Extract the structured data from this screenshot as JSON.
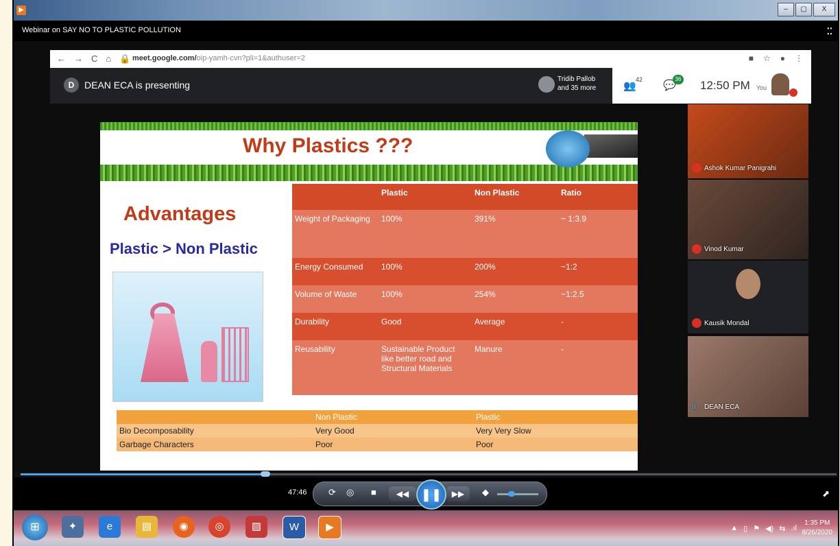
{
  "window": {
    "title": "Webinar on SAY NO TO PLASTIC POLLUTION",
    "minimize": "–",
    "maximize": "▢",
    "close": "X"
  },
  "browser": {
    "url_main": "meet.google.com/",
    "url_rest": "oip-yamh-cvn?pli=1&authuser=2"
  },
  "meet": {
    "presenter_initial": "D",
    "presenting_text": "DEAN ECA is presenting",
    "participants_line1": "Tridib Pallob",
    "participants_line2": "and 35 more",
    "people_count": "42",
    "chat_count": "36",
    "clock": "12:50 PM",
    "you_label": "You"
  },
  "slide": {
    "title": "Why Plastics ???",
    "advantages": "Advantages",
    "subtitle": "Plastic > Non Plastic",
    "table_headers": [
      "",
      "Plastic",
      "Non Plastic",
      "Ratio"
    ],
    "rows": [
      [
        "Weight of Packaging",
        "100%",
        "391%",
        "~ 1:3.9"
      ],
      [
        "Energy Consumed",
        "100%",
        "200%",
        "~1:2"
      ],
      [
        "Volume of Waste",
        "100%",
        "254%",
        "~1:2.5"
      ],
      [
        "Durability",
        "Good",
        "Average",
        "-"
      ],
      [
        "Reusability",
        "Sustainable Product like better road and Structural Materials",
        "Manure",
        "-"
      ]
    ],
    "bottom_headers": [
      "",
      "Non Plastic",
      "Plastic"
    ],
    "bottom_rows": [
      [
        "Bio Decomposability",
        "Very Good",
        "Very Very Slow"
      ],
      [
        "Garbage Characters",
        "Poor",
        "Poor"
      ]
    ]
  },
  "thumbnails": [
    {
      "name": "Ashok Kumar Panigrahi",
      "muted": true
    },
    {
      "name": "Vinod Kumar",
      "muted": true
    },
    {
      "name": "Kausik Mondal",
      "muted": true
    },
    {
      "name": "DEAN ECA",
      "muted": false
    }
  ],
  "player": {
    "time": "47:46",
    "progress": 0.3
  },
  "taskbar": {
    "time": "1:35 PM",
    "date": "8/26/2020"
  }
}
